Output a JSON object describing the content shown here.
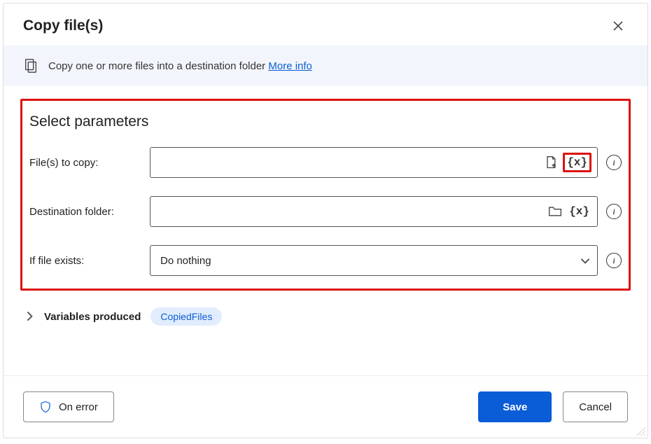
{
  "header": {
    "title": "Copy file(s)"
  },
  "banner": {
    "text": "Copy one or more files into a destination folder",
    "link": "More info"
  },
  "section": {
    "title": "Select parameters",
    "rows": {
      "files": {
        "label": "File(s) to copy:",
        "value": ""
      },
      "dest": {
        "label": "Destination folder:",
        "value": ""
      },
      "exists": {
        "label": "If file exists:",
        "selected": "Do nothing"
      }
    }
  },
  "variables": {
    "label": "Variables produced",
    "chip": "CopiedFiles"
  },
  "footer": {
    "onError": "On error",
    "save": "Save",
    "cancel": "Cancel"
  }
}
